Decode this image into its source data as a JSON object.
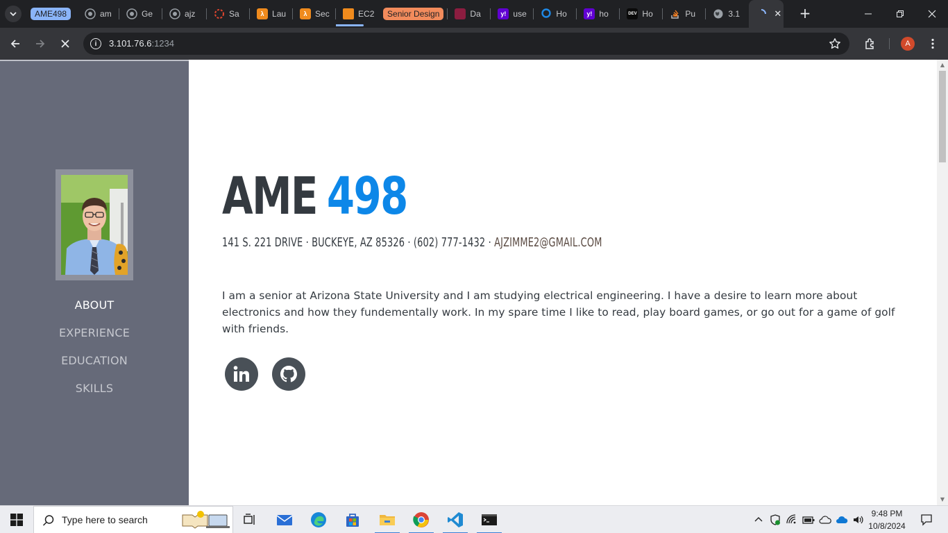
{
  "browser": {
    "tab_group_label": "AME498",
    "tab_group_color": "#8ab4f8",
    "senior_design_label": "Senior Design",
    "senior_design_color": "#f28b5c",
    "tabs": [
      {
        "label": "am",
        "icon": "github-icon"
      },
      {
        "label": "Ge",
        "icon": "github-icon"
      },
      {
        "label": "ajz",
        "icon": "github-icon"
      },
      {
        "label": "Sa",
        "icon": "loading-ring-icon"
      },
      {
        "label": "Lau",
        "icon": "aws-lambda-icon"
      },
      {
        "label": "Sec",
        "icon": "aws-lambda-icon"
      },
      {
        "label": "EC2",
        "icon": "aws-ec2-icon"
      },
      {
        "label": "Da",
        "icon": "asu-icon"
      },
      {
        "label": "use",
        "icon": "yahoo-icon"
      },
      {
        "label": "Ho",
        "icon": "digitalocean-icon"
      },
      {
        "label": "ho",
        "icon": "yahoo-icon"
      },
      {
        "label": "Ho",
        "icon": "dev-icon"
      },
      {
        "label": "Pu",
        "icon": "stackoverflow-icon"
      },
      {
        "label": "3.1",
        "icon": "globe-icon"
      }
    ],
    "active_tab_icon": "loading-spinner-icon",
    "url_host": "3.101.76.6",
    "url_port": ":1234"
  },
  "page": {
    "title_main": "AME",
    "title_accent": "498",
    "contact": "141 S. 221 DRIVE · BUCKEYE, AZ 85326 · (602) 777-1432 · ",
    "email": "AJZIMME2@GMAIL.COM",
    "bio": "I am a senior at Arizona State University and I am studying electrical engineering. I have a desire to learn more about electronics and how they fundementally work. In my spare time I like to read, play board games, or go out for a game of golf with friends.",
    "nav": [
      {
        "label": "ABOUT",
        "active": true
      },
      {
        "label": "EXPERIENCE",
        "active": false
      },
      {
        "label": "EDUCATION",
        "active": false
      },
      {
        "label": "SKILLS",
        "active": false
      }
    ],
    "social": [
      {
        "icon": "linkedin-icon"
      },
      {
        "icon": "github-icon"
      }
    ],
    "accent_color": "#0d87e8",
    "sidebar_color": "#666a79"
  },
  "taskbar": {
    "search_placeholder": "Type here to search",
    "time": "9:48 PM",
    "date": "10/8/2024"
  }
}
